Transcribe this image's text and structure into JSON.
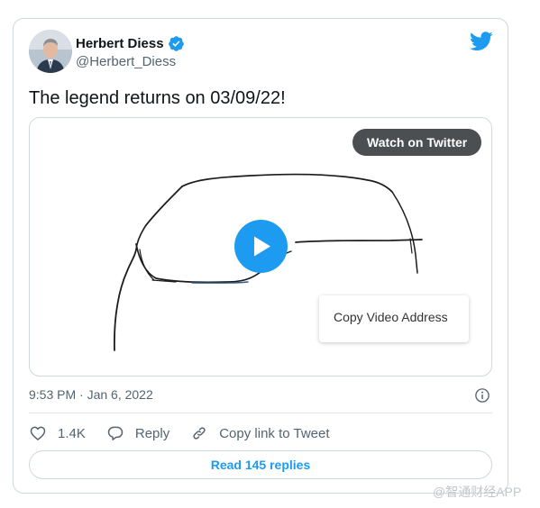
{
  "tweet": {
    "author": {
      "name": "Herbert Diess",
      "handle": "@Herbert_Diess",
      "verified": true
    },
    "text": "The legend returns on 03/09/22!",
    "media": {
      "watch_label": "Watch on Twitter",
      "context_menu_item": "Copy Video Address"
    },
    "timestamp": "9:53 PM · Jan 6, 2022",
    "actions": {
      "likes": "1.4K",
      "reply": "Reply",
      "copy_link": "Copy link to Tweet"
    },
    "read_replies": "Read 145 replies"
  },
  "watermark": "@智通财经APP",
  "colors": {
    "accent": "#1d9bf0",
    "text": "#0f1419",
    "secondary": "#536471",
    "border": "#cfd9de"
  },
  "icons": [
    "twitter-bird-icon",
    "verified-badge-icon",
    "play-icon",
    "info-icon",
    "heart-icon",
    "reply-icon",
    "link-icon"
  ]
}
